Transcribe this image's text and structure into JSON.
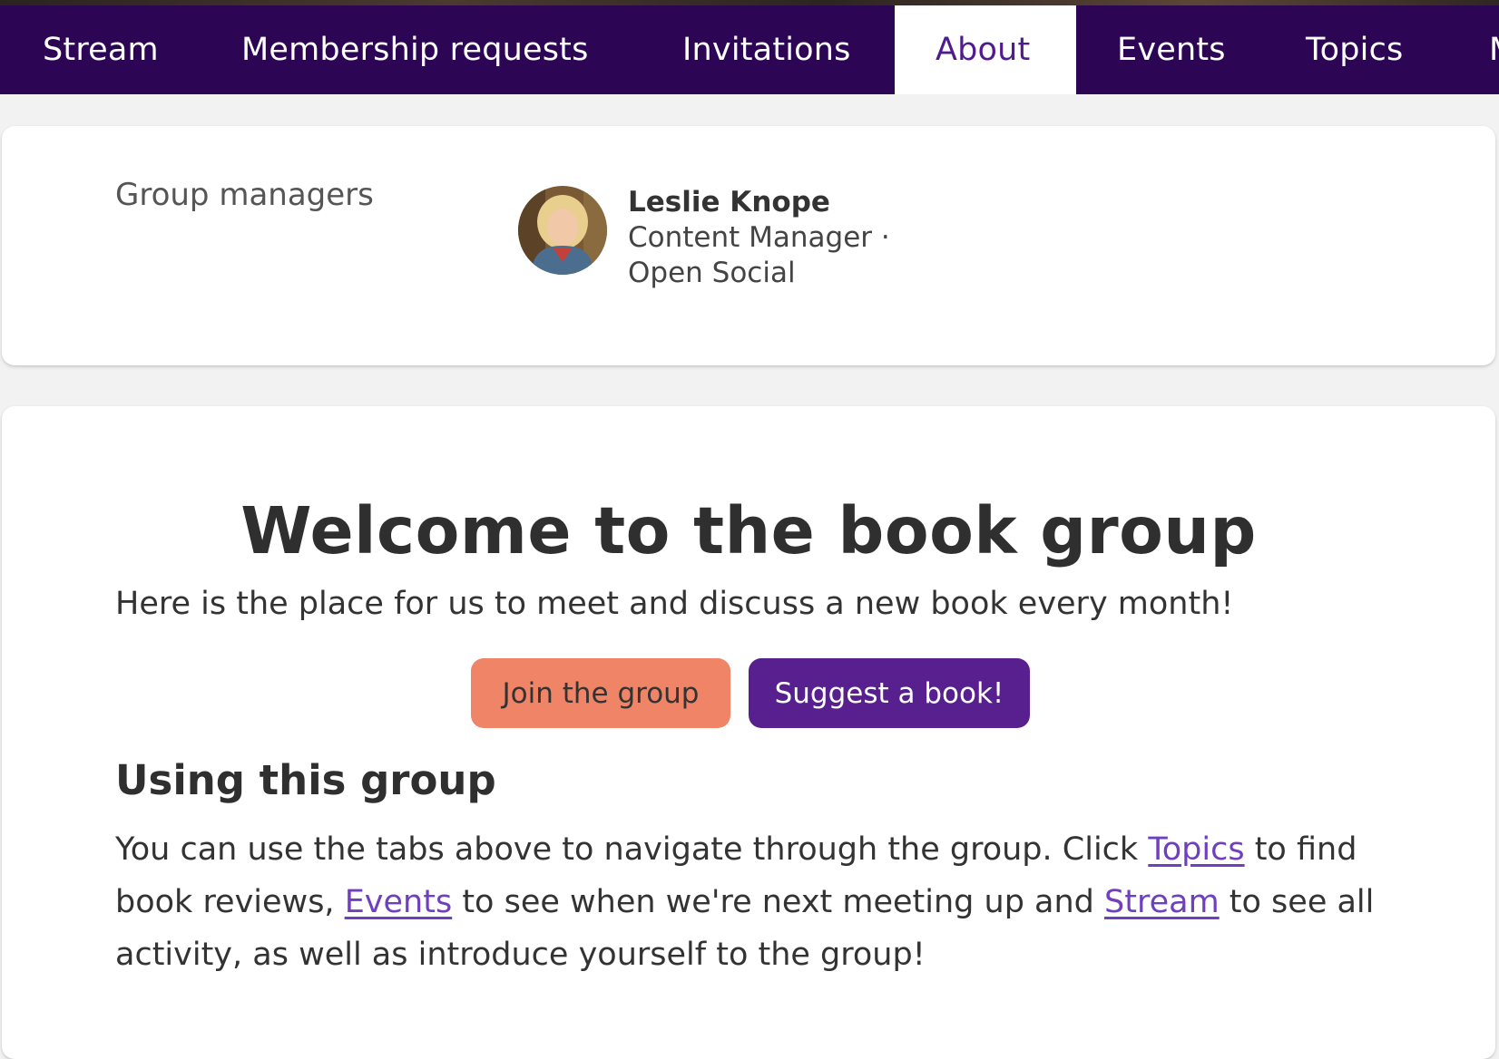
{
  "tabs": {
    "items": [
      {
        "label": "Stream"
      },
      {
        "label": "Membership requests"
      },
      {
        "label": "Invitations"
      },
      {
        "label": "About"
      },
      {
        "label": "Events"
      },
      {
        "label": "Topics"
      },
      {
        "label": "M"
      }
    ],
    "active": "About"
  },
  "managers": {
    "label": "Group managers",
    "manager": {
      "name": "Leslie Knope",
      "role": "Content Manager ·",
      "organization": "Open Social"
    }
  },
  "welcome": {
    "title": "Welcome to the book group",
    "intro": "Here is the place for us to meet and discuss a new book every month!",
    "join_button": "Join the group",
    "suggest_button": "Suggest a book!"
  },
  "using": {
    "title": "Using this group",
    "text1": "You can use the tabs above to navigate through the group. Click ",
    "link_topics": "Topics",
    "text2": " to find book reviews, ",
    "link_events": "Events",
    "text3": " to see when we're next meeting up and ",
    "link_stream": "Stream",
    "text4": " to see all activity, as well as introduce yourself to the group!"
  },
  "colors": {
    "nav_bg": "#2d0555",
    "active_tab_text": "#4f1b8f",
    "join_button": "#ef8466",
    "suggest_button": "#57208e",
    "link": "#6f3fbf"
  }
}
